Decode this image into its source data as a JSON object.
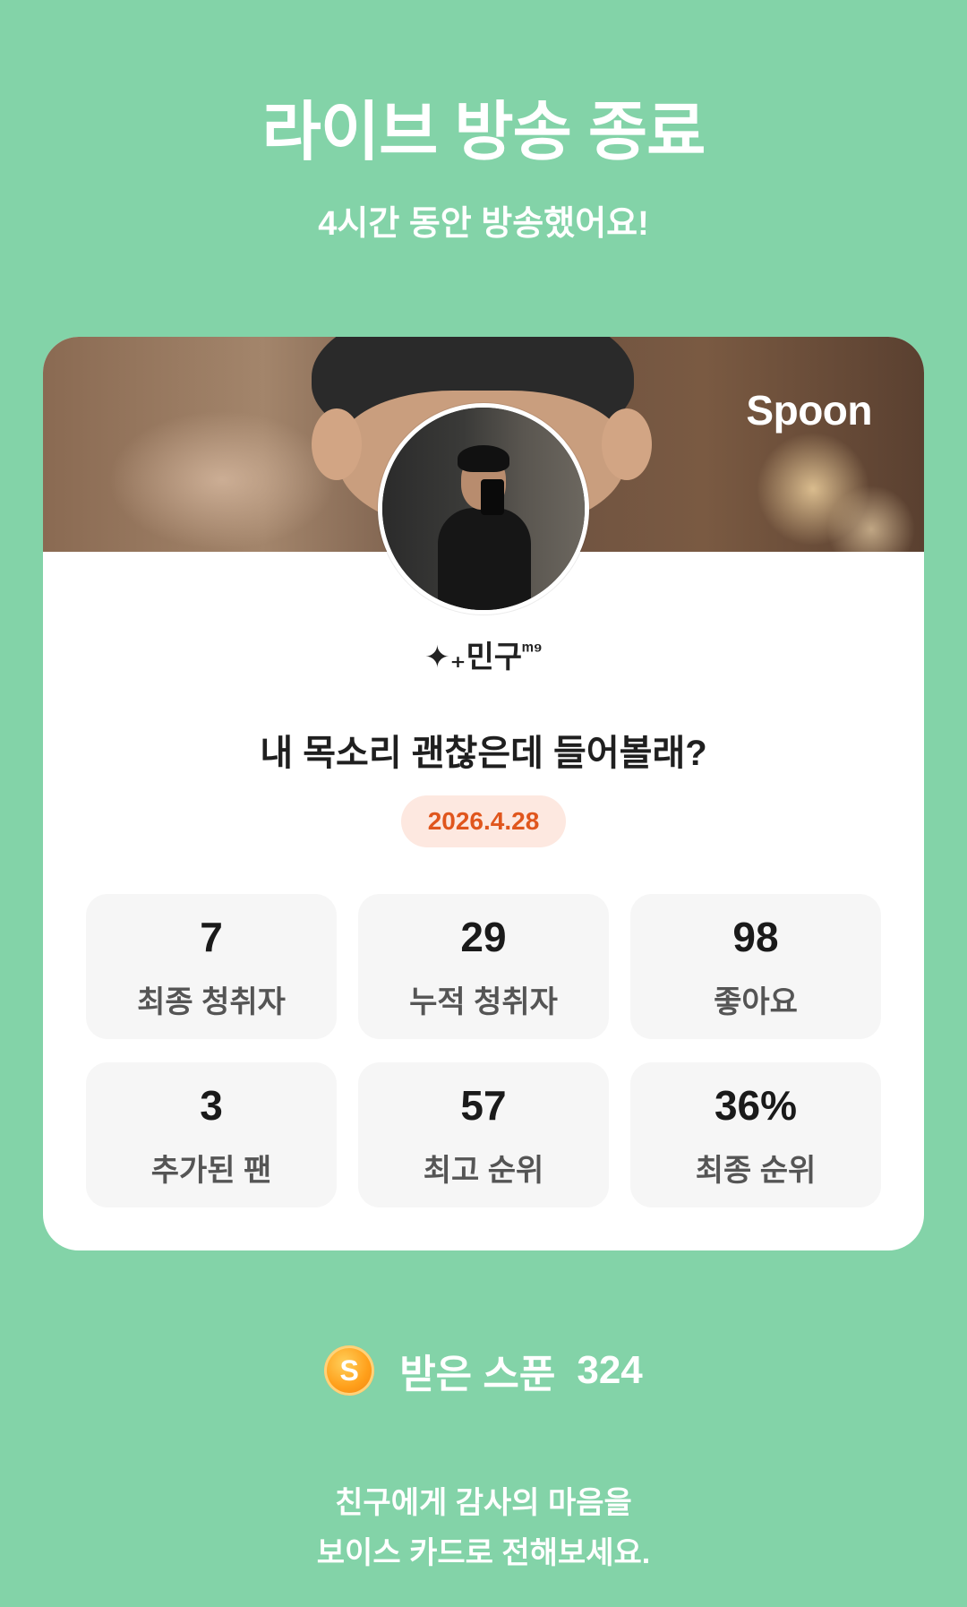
{
  "header": {
    "title": "라이브 방송 종료",
    "subtitle": "4시간 동안 방송했어요!"
  },
  "card": {
    "brand": "Spoon",
    "avatar_icon": "avatar-photo",
    "nickname": "민구",
    "nickname_prefix": "✦₊",
    "nickname_suffix": "ᵐ⁹",
    "broadcast_title": "내 목소리 괜찮은데 들어볼래?",
    "date": "2026.4.28",
    "stats": [
      {
        "value": "7",
        "label": "최종 청취자"
      },
      {
        "value": "29",
        "label": "누적 청취자"
      },
      {
        "value": "98",
        "label": "좋아요"
      },
      {
        "value": "3",
        "label": "추가된 팬"
      },
      {
        "value": "57",
        "label": "최고 순위"
      },
      {
        "value": "36%",
        "label": "최종 순위"
      }
    ]
  },
  "spoons": {
    "icon": "spoon-coin-icon",
    "icon_letter": "S",
    "label": "받은 스푼",
    "count": "324"
  },
  "footer": {
    "line1": "친구에게 감사의 마음을",
    "line2": "보이스 카드로 전해보세요."
  },
  "colors": {
    "background": "#83d3a8",
    "date_text": "#e0561d",
    "date_pill": "#fde8e0",
    "spoon_coin": "#ff9f1a"
  }
}
